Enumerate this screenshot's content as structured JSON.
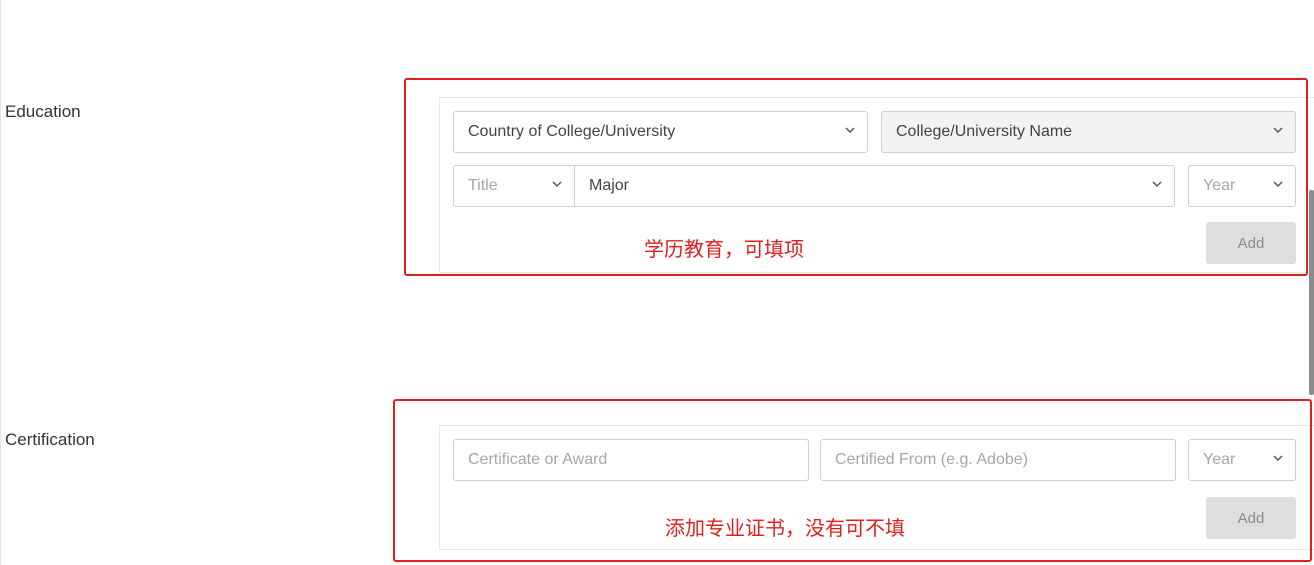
{
  "education": {
    "label": "Education",
    "country_placeholder": "Country of College/University",
    "college_placeholder": "College/University Name",
    "title_placeholder": "Title",
    "major_placeholder": "Major",
    "year_placeholder": "Year",
    "add_label": "Add",
    "annotation": "学历教育，可填项"
  },
  "certification": {
    "label": "Certification",
    "certificate_placeholder": "Certificate or Award",
    "certified_from_placeholder": "Certified From (e.g. Adobe)",
    "year_placeholder": "Year",
    "add_label": "Add",
    "annotation": "添加专业证书，没有可不填"
  },
  "colors": {
    "annotation_red": "#e0201e",
    "add_button_bg": "#dedede",
    "field_border": "#cfcfcf"
  },
  "icons": {
    "dropdown": "chevron-down-icon"
  }
}
